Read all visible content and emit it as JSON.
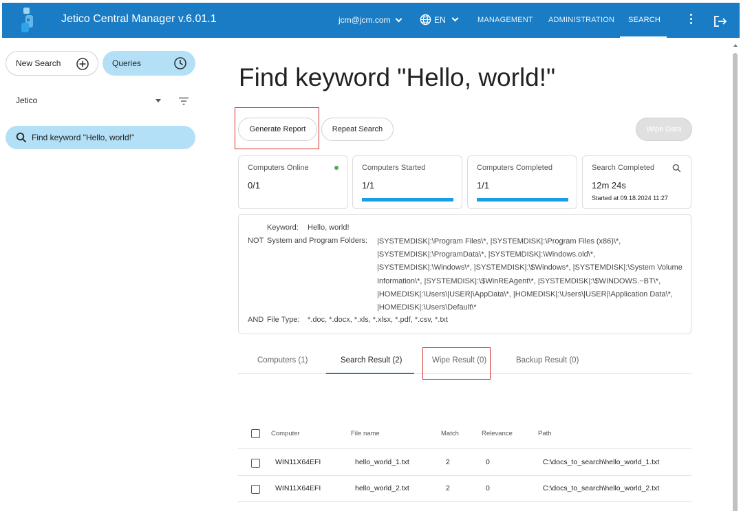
{
  "header": {
    "app_title": "Jetico Central Manager  v.6.01.1",
    "user": "jcm@jcm.com",
    "language": "EN",
    "nav": [
      {
        "label": "MANAGEMENT"
      },
      {
        "label": "ADMINISTRATION"
      },
      {
        "label": "SEARCH"
      }
    ],
    "colors": {
      "bar": "#1a7cc4"
    }
  },
  "sidebar": {
    "new_search_label": "New Search",
    "queries_label": "Queries",
    "organization": "Jetico",
    "query_item": "Find keyword \"Hello, world!\""
  },
  "main": {
    "title": "Find keyword \"Hello, world!\"",
    "buttons": {
      "generate_report": "Generate Report",
      "repeat_search": "Repeat Search",
      "wipe_data": "Wipe Data"
    },
    "cards": {
      "online": {
        "label": "Computers Online",
        "value": "0/1"
      },
      "started": {
        "label": "Computers Started",
        "value": "1/1",
        "progress": 1.0
      },
      "completed": {
        "label": "Computers Completed",
        "value": "1/1",
        "progress": 1.0
      },
      "search_completed": {
        "label": "Search Completed",
        "value": "12m 24s",
        "sub": "Started at 09.18.2024 11:27"
      }
    },
    "criteria": {
      "keyword_label": "Keyword:",
      "keyword_value": "Hello, world!",
      "not_op": "NOT",
      "folders_label": "System and Program Folders:",
      "folders_value": "|SYSTEMDISK|:\\Program Files\\*, |SYSTEMDISK|:\\Program Files (x86)\\*, |SYSTEMDISK|:\\ProgramData\\*, |SYSTEMDISK|:\\Windows.old\\*, |SYSTEMDISK|:\\Windows\\*, |SYSTEMDISK|:\\$Windows*, |SYSTEMDISK|:\\System Volume Information\\*, |SYSTEMDISK|:\\$WinREAgent\\*, |SYSTEMDISK|:\\$WINDOWS.~BT\\*, |HOMEDISK|:\\Users\\|USER|\\AppData\\*, |HOMEDISK|:\\Users\\|USER|\\Application Data\\*, |HOMEDISK|:\\Users\\Default\\*",
      "and_op": "AND",
      "filetype_label": "File Type:",
      "filetype_value": "*.doc, *.docx, *.xls, *.xlsx, *.pdf, *.csv, *.txt"
    },
    "tabs": [
      {
        "label": "Computers (1)"
      },
      {
        "label": "Search Result (2)"
      },
      {
        "label": "Wipe Result (0)"
      },
      {
        "label": "Backup Result (0)"
      }
    ],
    "table": {
      "columns": [
        "Computer",
        "File name",
        "Match",
        "Relevance",
        "Path"
      ],
      "rows": [
        {
          "computer": "WIN11X64EFI",
          "file": "hello_world_1.txt",
          "match": "2",
          "relevance": "0",
          "path": "C:\\docs_to_search\\hello_world_1.txt"
        },
        {
          "computer": "WIN11X64EFI",
          "file": "hello_world_2.txt",
          "match": "2",
          "relevance": "0",
          "path": "C:\\docs_to_search\\hello_world_2.txt"
        }
      ]
    }
  }
}
